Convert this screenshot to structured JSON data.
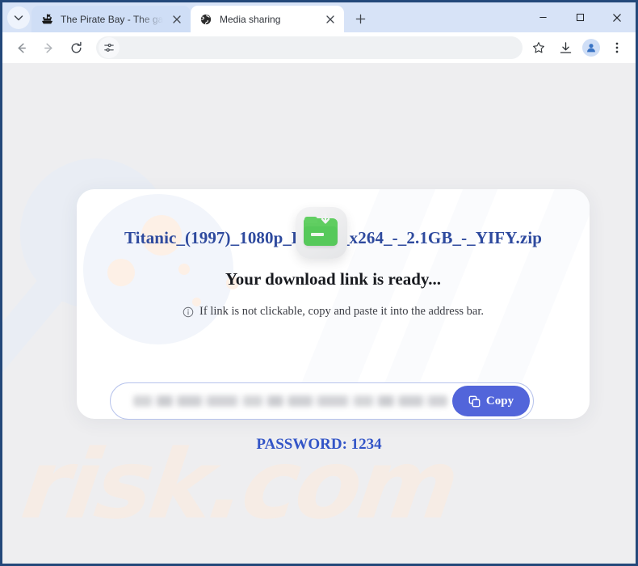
{
  "window": {
    "controls": {
      "minimize": "minimize-button",
      "maximize": "maximize-button",
      "close": "close-button"
    }
  },
  "tabstrip": {
    "search_tabs_tooltip": "Search tabs",
    "new_tab_label": "+",
    "tabs": [
      {
        "title": "The Pirate Bay - The galaxy's m",
        "favicon": "pirate-ship-icon",
        "active": false,
        "close_label": "×"
      },
      {
        "title": "Media sharing",
        "favicon": "globe-icon",
        "active": true,
        "close_label": "×"
      }
    ]
  },
  "toolbar": {
    "back_label": "back-icon",
    "forward_label": "forward-icon",
    "reload_label": "reload-icon",
    "omnibox": {
      "value": "",
      "placeholder": "",
      "left_icon": "tune-settings-icon",
      "bookmark_icon": "star-icon"
    },
    "downloads_icon": "download-icon",
    "profile_icon": "profile-avatar-icon",
    "menu_icon": "three-dot-menu-icon"
  },
  "page": {
    "watermark": "risk.com",
    "file_name": "Titanic_(1997)_1080p_HDTV_x264_-_2.1GB_-_YIFY.zip",
    "headline": "Your download link is ready...",
    "note": "If link is not clickable, copy and paste it into the address bar.",
    "note_icon": "info-circle-icon",
    "download_icon": "green-folder-download-icon",
    "url_field": {
      "value": "",
      "redacted": true
    },
    "copy_button": {
      "label": "Copy",
      "icon": "copy-icon"
    },
    "password_text": "PASSWORD: 1234"
  },
  "colors": {
    "accent_blue": "#5265da",
    "link_blue": "#2e4a9e",
    "password_blue": "#3355c7",
    "folder_green": "#56c95a",
    "chrome_frame": "#d7e3f7",
    "window_border": "#23487a",
    "watermark": "#f6ece5"
  }
}
